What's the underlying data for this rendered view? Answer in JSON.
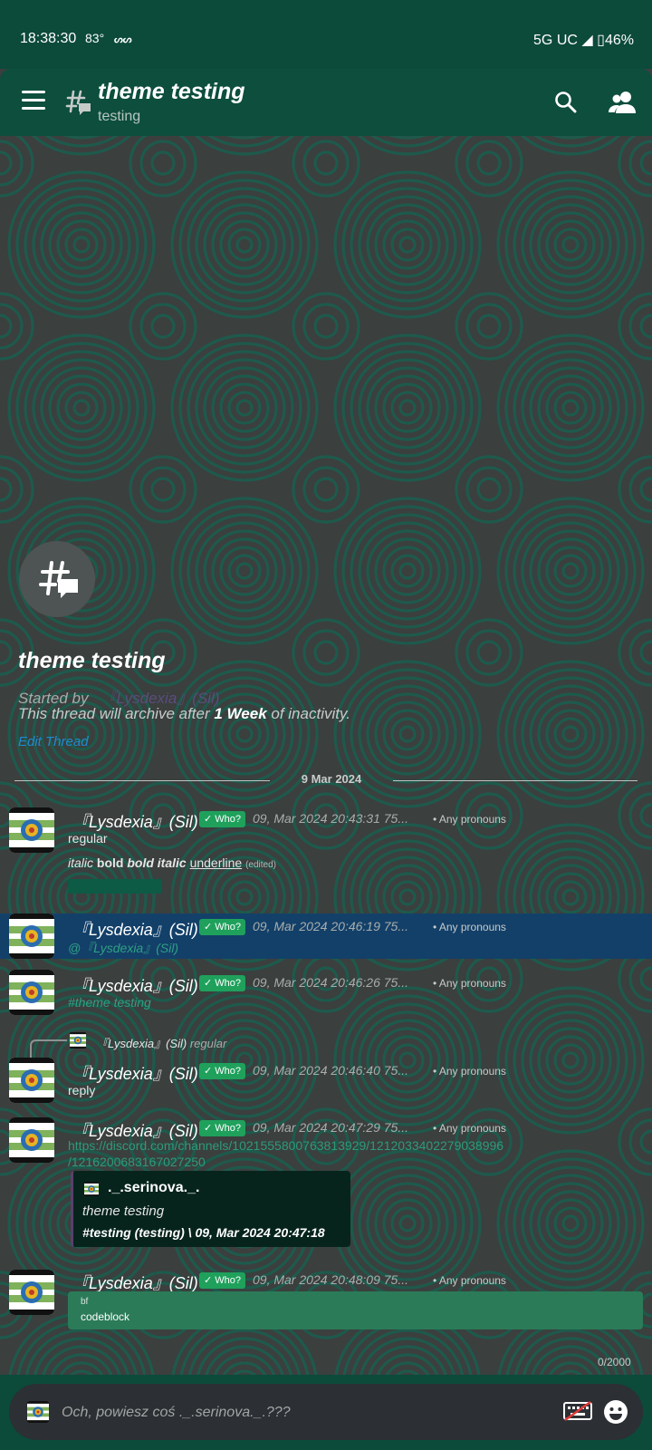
{
  "status_bar": {
    "time": "18:38:30",
    "temperature": "83°",
    "network": "5G UC",
    "battery": "46%"
  },
  "header": {
    "title": "theme testing",
    "subtitle": "testing"
  },
  "thread_intro": {
    "title": "theme testing",
    "started_by_label": "Started by",
    "author": "『Lysdexia』(Sil)",
    "archive_prefix": "This thread will archive after ",
    "archive_duration": "1 Week",
    "archive_suffix": " of inactivity.",
    "edit_label": "Edit Thread"
  },
  "date_divider": "9 Mar 2024",
  "messages": [
    {
      "author": "『Lysdexia』(Sil)",
      "badge": "✓ Who?",
      "timestamp": "09, Mar 2024 20:43:31 75...",
      "pronouns": "• Any pronouns",
      "line1": "regular",
      "fmt_italic": "italic",
      "fmt_bold": "bold",
      "fmt_bold_italic": "bold italic",
      "fmt_underline": "underline",
      "edited": "(edited)"
    },
    {
      "author": "『Lysdexia』(Sil)",
      "badge": "✓ Who?",
      "timestamp": "09, Mar 2024 20:46:19 75...",
      "pronouns": "• Any pronouns",
      "mention": "@『Lysdexia』(Sil)"
    },
    {
      "author": "『Lysdexia』(Sil)",
      "badge": "✓ Who?",
      "timestamp": "09, Mar 2024 20:46:26 75...",
      "pronouns": "• Any pronouns",
      "channel": "#theme testing"
    },
    {
      "reply_author": "『Lysdexia』(Sil)",
      "reply_text": "regular",
      "author": "『Lysdexia』(Sil)",
      "badge": "✓ Who?",
      "timestamp": "09, Mar 2024 20:46:40 75...",
      "pronouns": "• Any pronouns",
      "text": "reply"
    },
    {
      "author": "『Lysdexia』(Sil)",
      "badge": "✓ Who?",
      "timestamp": "09, Mar 2024 20:47:29 75...",
      "pronouns": "• Any pronouns",
      "link_line1": "https://discord.com/channels/1021555800763813929/1212033402279038996",
      "link_line2": "/1216200683167027250",
      "embed_author": "._.serinova._.",
      "embed_text": "theme testing",
      "embed_footer": "#testing (testing) \\ 09, Mar 2024 20:47:18"
    },
    {
      "author": "『Lysdexia』(Sil)",
      "badge": "✓ Who?",
      "timestamp": "09, Mar 2024 20:48:09 75...",
      "pronouns": "• Any pronouns",
      "code_lang": "bf",
      "code_text": "codeblock"
    }
  ],
  "composer": {
    "char_count": "0/2000",
    "placeholder": "Och, powiesz coś ._.serinova._.???"
  },
  "colors": {
    "theme_green": "#0c4a3a",
    "mention_highlight": "#134069",
    "role_badge": "#1fa15c",
    "link": "#2e9a79",
    "codeblock": "#2b7b58"
  },
  "icons": [
    "menu-icon",
    "thread-icon",
    "search-icon",
    "members-icon",
    "keyboard-icon",
    "emoji-icon"
  ]
}
